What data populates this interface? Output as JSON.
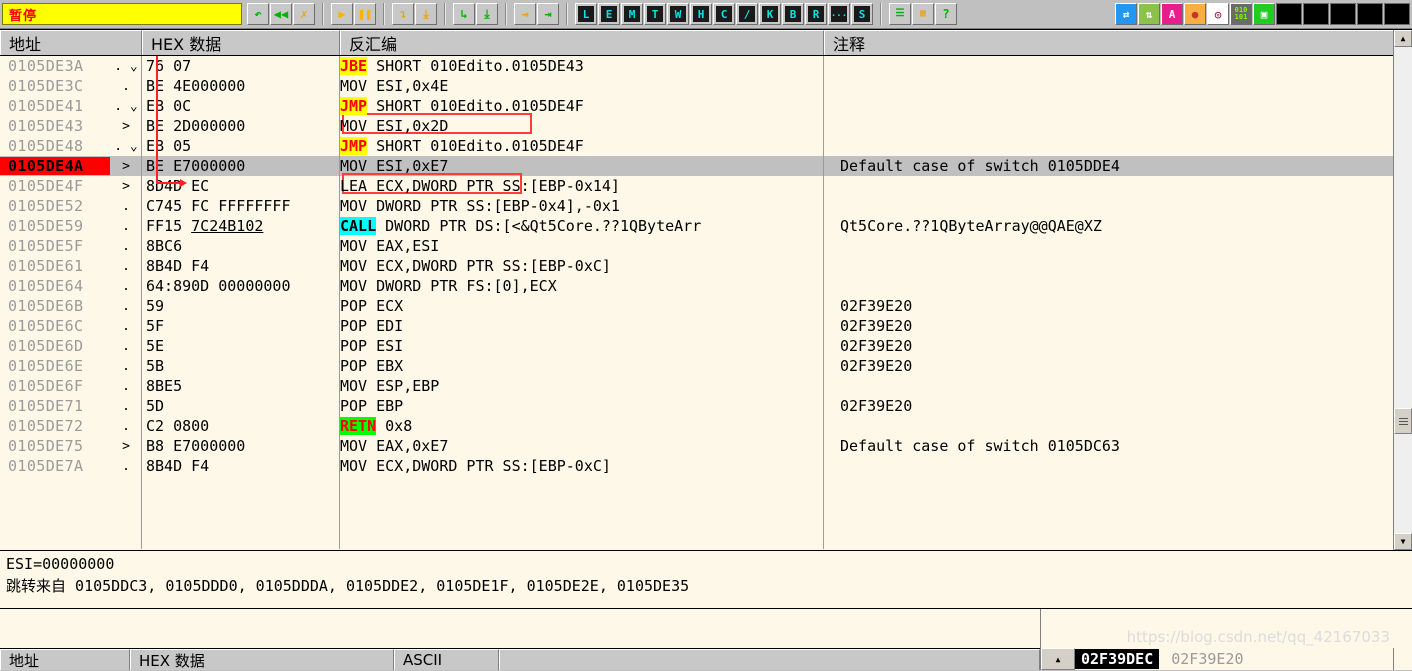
{
  "toolbar": {
    "status_label": "暂停",
    "nav_icons": [
      "restart-icon",
      "rewind-icon",
      "close-icon"
    ],
    "run_icons": [
      "run-icon",
      "pause-icon"
    ],
    "step_icons": [
      "step-into-icon",
      "step-over-icon",
      "trace-into-icon",
      "trace-over-icon",
      "execute-till-return-icon",
      "run-to-user-code-icon"
    ],
    "letter_buttons": [
      "L",
      "E",
      "M",
      "T",
      "W",
      "H",
      "C",
      "/",
      "K",
      "B",
      "R",
      "...",
      "S"
    ],
    "extra_buttons": [
      "list-icon",
      "memory-map-icon",
      "help-icon"
    ],
    "right_buttons": [
      "compare-icon",
      "updown-icon",
      "A",
      "record-icon",
      "target-icon",
      "binary-icon",
      "window-icon"
    ],
    "blank_buttons": 5
  },
  "cpu": {
    "columns": [
      "地址",
      "HEX 数据",
      "反汇编",
      "注释"
    ],
    "rows": [
      {
        "addr": "0105DE3A",
        "mark": ". ⌄",
        "hex": "76 07",
        "kw": "JBE",
        "kwtype": "y",
        "dis": " SHORT 010Edito.0105DE43",
        "comment": ""
      },
      {
        "addr": "0105DE3C",
        "mark": ".",
        "hex": "BE 4E000000",
        "kw": "",
        "kwtype": "",
        "dis": "MOV ESI,0x4E",
        "comment": ""
      },
      {
        "addr": "0105DE41",
        "mark": ". ⌄",
        "hex": "EB 0C",
        "kw": "JMP",
        "kwtype": "y",
        "dis": " SHORT 010Edito.0105DE4F",
        "comment": ""
      },
      {
        "addr": "0105DE43",
        "mark": ">",
        "hex": "BE 2D000000",
        "kw": "",
        "kwtype": "",
        "dis": "MOV ESI,0x2D",
        "comment": ""
      },
      {
        "addr": "0105DE48",
        "mark": ". ⌄",
        "hex": "EB 05",
        "kw": "JMP",
        "kwtype": "y",
        "dis": " SHORT 010Edito.0105DE4F",
        "comment": ""
      },
      {
        "addr": "0105DE4A",
        "mark": ">",
        "hex": "BE E7000000",
        "kw": "",
        "kwtype": "",
        "dis": "MOV ESI,0xE7",
        "comment": "Default case of switch 0105DDE4",
        "selected": true
      },
      {
        "addr": "0105DE4F",
        "mark": ">",
        "hex": "8D4D EC",
        "kw": "",
        "kwtype": "",
        "dis": "LEA ECX,DWORD PTR SS:[EBP-0x14]",
        "comment": ""
      },
      {
        "addr": "0105DE52",
        "mark": ".",
        "hex": "C745 FC FFFFFFFF",
        "kw": "",
        "kwtype": "",
        "dis": "MOV DWORD PTR SS:[EBP-0x4],-0x1",
        "comment": ""
      },
      {
        "addr": "0105DE59",
        "mark": ".",
        "hex": "FF15 7C24B102",
        "hexunderline": "7C24B102",
        "kw": "CALL",
        "kwtype": "c",
        "dis": " DWORD PTR DS:[<&Qt5Core.??1QByteArr",
        "comment": "Qt5Core.??1QByteArray@@QAE@XZ"
      },
      {
        "addr": "0105DE5F",
        "mark": ".",
        "hex": "8BC6",
        "kw": "",
        "kwtype": "",
        "dis": "MOV EAX,ESI",
        "comment": ""
      },
      {
        "addr": "0105DE61",
        "mark": ".",
        "hex": "8B4D F4",
        "kw": "",
        "kwtype": "",
        "dis": "MOV ECX,DWORD PTR SS:[EBP-0xC]",
        "comment": ""
      },
      {
        "addr": "0105DE64",
        "mark": ".",
        "hex": "64:890D 00000000",
        "kw": "",
        "kwtype": "",
        "dis": "MOV DWORD PTR FS:[0],ECX",
        "comment": ""
      },
      {
        "addr": "0105DE6B",
        "mark": ".",
        "hex": "59",
        "kw": "",
        "kwtype": "",
        "dis": "POP ECX",
        "comment": "02F39E20"
      },
      {
        "addr": "0105DE6C",
        "mark": ".",
        "hex": "5F",
        "kw": "",
        "kwtype": "",
        "dis": "POP EDI",
        "comment": "02F39E20"
      },
      {
        "addr": "0105DE6D",
        "mark": ".",
        "hex": "5E",
        "kw": "",
        "kwtype": "",
        "dis": "POP ESI",
        "comment": "02F39E20"
      },
      {
        "addr": "0105DE6E",
        "mark": ".",
        "hex": "5B",
        "kw": "",
        "kwtype": "",
        "dis": "POP EBX",
        "comment": "02F39E20"
      },
      {
        "addr": "0105DE6F",
        "mark": ".",
        "hex": "8BE5",
        "kw": "",
        "kwtype": "",
        "dis": "MOV ESP,EBP",
        "comment": ""
      },
      {
        "addr": "0105DE71",
        "mark": ".",
        "hex": "5D",
        "kw": "",
        "kwtype": "",
        "dis": "POP EBP",
        "comment": "02F39E20"
      },
      {
        "addr": "0105DE72",
        "mark": ".",
        "hex": "C2 0800",
        "kw": "RETN",
        "kwtype": "g",
        "dis": " 0x8",
        "comment": ""
      },
      {
        "addr": "0105DE75",
        "mark": ">",
        "hex": "B8 E7000000",
        "kw": "",
        "kwtype": "",
        "dis": "MOV EAX,0xE7",
        "comment": "Default case of switch 0105DC63"
      },
      {
        "addr": "0105DE7A",
        "mark": ".",
        "hex": "8B4D F4",
        "kw": "",
        "kwtype": "",
        "dis": "MOV ECX,DWORD PTR SS:[EBP-0xC]",
        "comment": ""
      }
    ]
  },
  "info": {
    "register_line": "ESI=00000000",
    "jump_from_label": "跳转来自",
    "jump_from_values": "0105DDC3, 0105DDD0, 0105DDDA, 0105DDE2, 0105DE1F, 0105DE2E, 0105DE35"
  },
  "dump": {
    "columns": [
      "地址",
      "HEX 数据",
      "ASCII"
    ]
  },
  "stack": {
    "selected_value": "02F39DEC",
    "value": "02F39E20"
  },
  "watermark": "https://blog.csdn.net/qq_42167033",
  "colors": {
    "background": "#fdf8e8",
    "chrome": "#c0c0c0",
    "selection": "#c0c0c0",
    "eip_marker": "#ff0000",
    "jump_arrow": "#ff2020",
    "annotation": "#ff3b3b",
    "status": "#ffff00",
    "address_text": "#9a9a9a"
  }
}
